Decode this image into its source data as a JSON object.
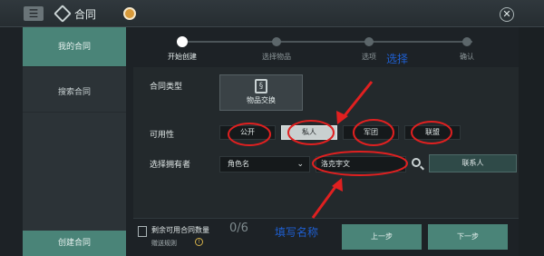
{
  "header": {
    "menu_icon": "menu-icon",
    "app_icon": "hexagon-icon",
    "title": "合同",
    "radio_icon": "radio-icon",
    "close_icon": "close-icon"
  },
  "sidebar": {
    "items": [
      {
        "label": "我的合同"
      },
      {
        "label": "搜索合同"
      }
    ],
    "bottom_label": "创建合同"
  },
  "steps": [
    {
      "label": "开始创建"
    },
    {
      "label": "选择物品"
    },
    {
      "label": "选项"
    },
    {
      "label": "确认"
    }
  ],
  "form": {
    "contract_type_label": "合同类型",
    "contract_type_item": "物品交换",
    "availability_label": "可用性",
    "availability_options": [
      {
        "label": "公开"
      },
      {
        "label": "私人"
      },
      {
        "label": "军团"
      },
      {
        "label": "联盟"
      }
    ],
    "selected_availability": "私人",
    "owner_label": "选择拥有者",
    "owner_type_value": "角色名",
    "owner_name_value": "洛克宇文",
    "contact_button": "联系人"
  },
  "footer": {
    "remaining_label": "剩余可用合同数量",
    "remaining_count": "0/6",
    "rules_label": "赠送规则",
    "prev_button": "上一步",
    "next_button": "下一步"
  },
  "annotations": {
    "choose": "选择",
    "fill_name": "填写名称"
  },
  "colors": {
    "accent": "#4a8478",
    "annotation_red": "#e02020",
    "annotation_blue": "#1e5fd1",
    "selected_bg": "#c9d0d0"
  }
}
